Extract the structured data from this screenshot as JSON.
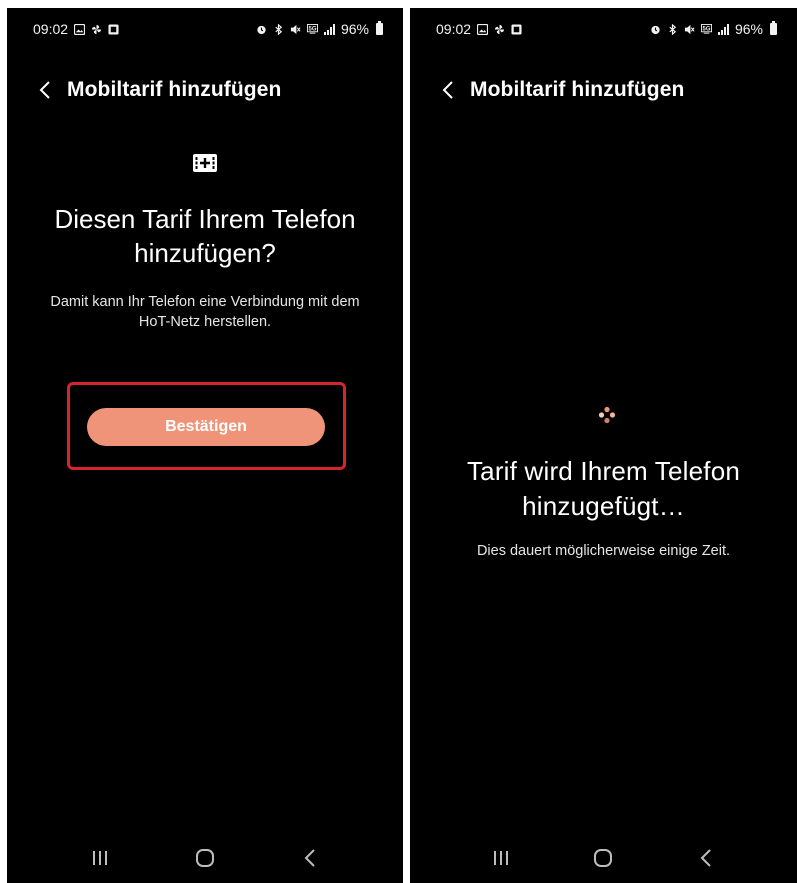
{
  "left": {
    "status": {
      "time": "09:02",
      "battery": "96%"
    },
    "header": {
      "title": "Mobiltarif hinzufügen"
    },
    "headline": "Diesen Tarif Ihrem Telefon hinzufügen?",
    "description": "Damit kann Ihr Telefon eine Verbindung mit dem HoT-Netz herstellen.",
    "confirm_label": "Bestätigen",
    "icons": [
      "back-icon",
      "sim-add-icon"
    ]
  },
  "right": {
    "status": {
      "time": "09:02",
      "battery": "96%"
    },
    "header": {
      "title": "Mobiltarif hinzufügen"
    },
    "progress_title": "Tarif wird Ihrem Telefon hinzugefügt…",
    "progress_description": "Dies dauert möglicherweise einige Zeit.",
    "icons": [
      "back-icon",
      "loading-spinner-icon"
    ]
  },
  "navbar": {
    "icons": [
      "recent-apps-icon",
      "home-icon",
      "back-nav-icon"
    ]
  },
  "colors": {
    "background": "#000000",
    "button": "#ef9479",
    "highlight": "#d4242e",
    "spinner": "#ef9479"
  }
}
